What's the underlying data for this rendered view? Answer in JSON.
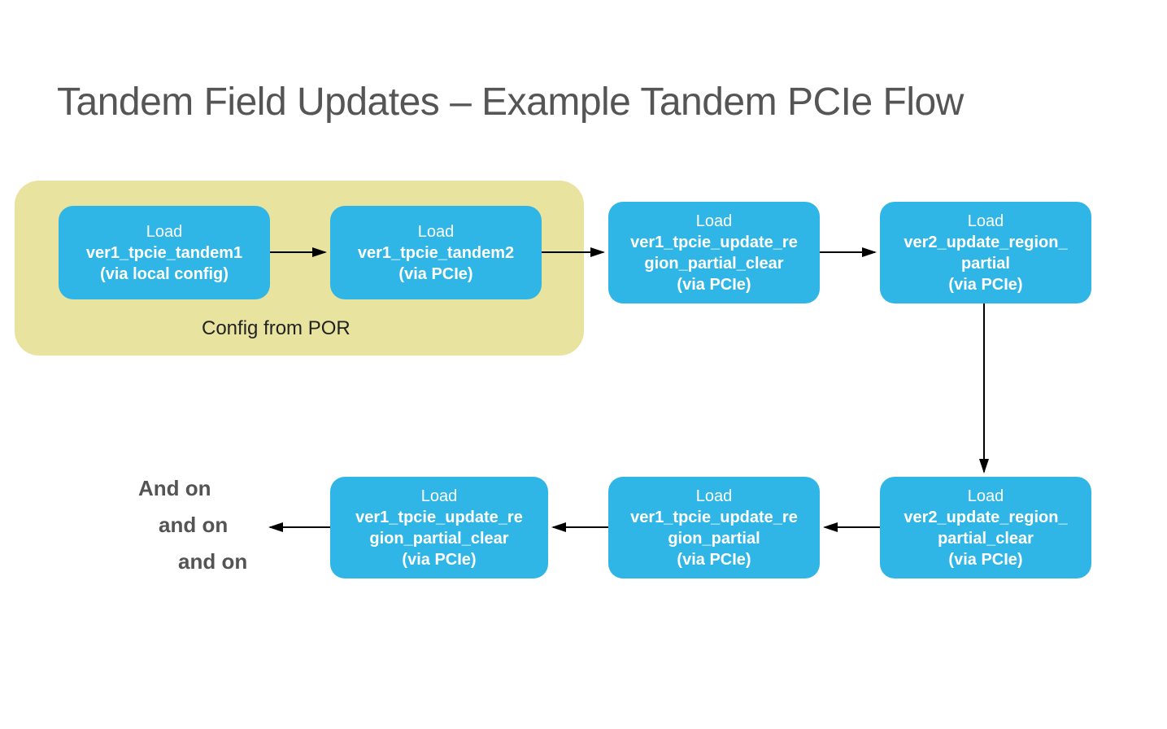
{
  "title": "Tandem Field Updates – Example Tandem PCIe Flow",
  "config_group_label": "Config from POR",
  "boxes": {
    "b1": {
      "load": "Load",
      "name": "ver1_tpcie_tandem1",
      "via": "(via local config)"
    },
    "b2": {
      "load": "Load",
      "name": "ver1_tpcie_tandem2",
      "via": "(via PCIe)"
    },
    "b3": {
      "load": "Load",
      "name": "ver1_tpcie_update_region_partial_clear",
      "via": "(via PCIe)"
    },
    "b4": {
      "load": "Load",
      "name": "ver2_update_region_partial",
      "via": "(via PCIe)"
    },
    "b5": {
      "load": "Load",
      "name": "ver2_update_region_partial_clear",
      "via": "(via PCIe)"
    },
    "b6": {
      "load": "Load",
      "name": "ver1_tpcie_update_region_partial",
      "via": "(via PCIe)"
    },
    "b7": {
      "load": "Load",
      "name": "ver1_tpcie_update_region_partial_clear",
      "via": "(via PCIe)"
    }
  },
  "andon": {
    "line1": "And on",
    "line2": "and on",
    "line3": "and on"
  },
  "colors": {
    "box_bg": "#2fb6e6",
    "group_bg": "#e8e39f",
    "title_color": "#555555"
  }
}
